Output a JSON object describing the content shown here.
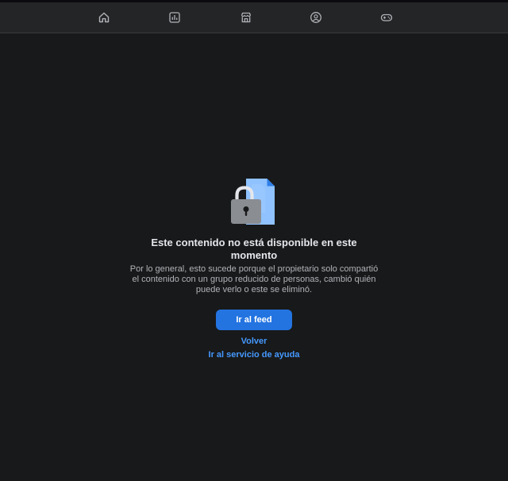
{
  "nav": {
    "items": [
      {
        "icon": "home-icon"
      },
      {
        "icon": "chart-icon"
      },
      {
        "icon": "marketplace-icon"
      },
      {
        "icon": "groups-icon"
      },
      {
        "icon": "gaming-icon"
      }
    ]
  },
  "error": {
    "icon": "lock-document-icon",
    "title": "Este contenido no está disponible en este momento",
    "description": "Por lo general, esto sucede porque el propietario solo compartió el contenido con un grupo reducido de personas, cambió quién puede verlo o este se eliminó.",
    "primary_button": "Ir al feed",
    "back_link": "Volver",
    "help_link": "Ir al servicio de ayuda"
  },
  "colors": {
    "background": "#18191a",
    "navbar": "#242526",
    "accent": "#2374e1",
    "link": "#4599ff"
  }
}
